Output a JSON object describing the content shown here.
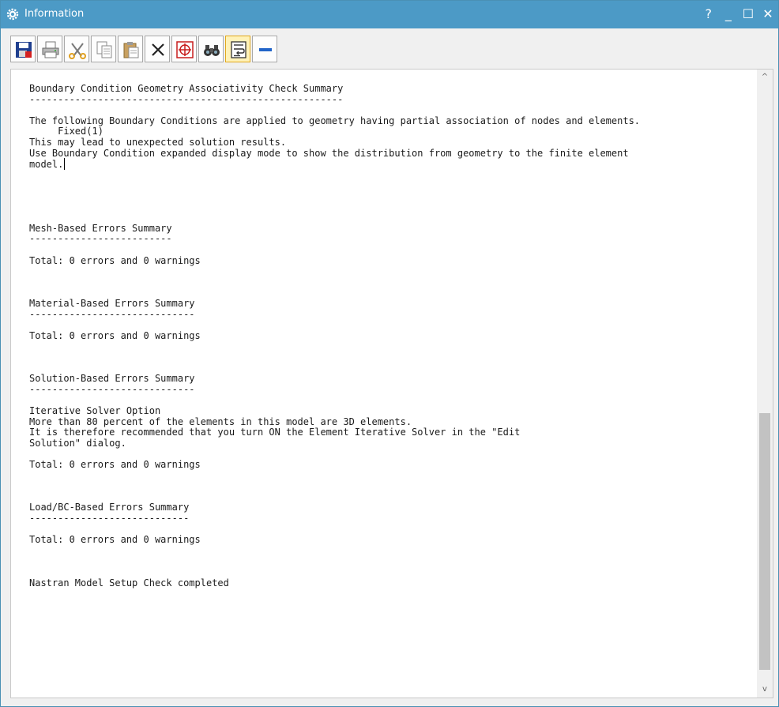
{
  "window": {
    "title": "Information",
    "controls": {
      "help": "?",
      "minimize": "_",
      "maximize": "☐",
      "close": "✕"
    }
  },
  "toolbar": {
    "buttons": [
      {
        "name": "save-button",
        "icon": "save-icon"
      },
      {
        "name": "print-button",
        "icon": "printer-icon"
      },
      {
        "name": "cut-button",
        "icon": "scissors-icon"
      },
      {
        "name": "copy-button",
        "icon": "copy-icon"
      },
      {
        "name": "paste-button",
        "icon": "paste-icon"
      },
      {
        "name": "delete-button",
        "icon": "x-icon"
      },
      {
        "name": "crosshair-button",
        "icon": "crosshair-icon"
      },
      {
        "name": "find-button",
        "icon": "binoculars-icon"
      },
      {
        "name": "word-wrap-button",
        "icon": "word-wrap-icon",
        "active": true
      },
      {
        "name": "collapse-button",
        "icon": "minus-icon"
      }
    ]
  },
  "content": {
    "lines": [
      "Boundary Condition Geometry Associativity Check Summary",
      "-------------------------------------------------------",
      "",
      "The following Boundary Conditions are applied to geometry having partial association of nodes and elements.",
      "     Fixed(1)",
      "This may lead to unexpected solution results.",
      "Use Boundary Condition expanded display mode to show the distribution from geometry to the finite element",
      "model.",
      "",
      "",
      "",
      "",
      "",
      "Mesh-Based Errors Summary",
      "-------------------------",
      "",
      "Total: 0 errors and 0 warnings",
      "",
      "",
      "",
      "Material-Based Errors Summary",
      "-----------------------------",
      "",
      "Total: 0 errors and 0 warnings",
      "",
      "",
      "",
      "Solution-Based Errors Summary",
      "-----------------------------",
      "",
      "Iterative Solver Option",
      "More than 80 percent of the elements in this model are 3D elements.",
      "It is therefore recommended that you turn ON the Element Iterative Solver in the \"Edit",
      "Solution\" dialog.",
      "",
      "Total: 0 errors and 0 warnings",
      "",
      "",
      "",
      "Load/BC-Based Errors Summary",
      "----------------------------",
      "",
      "Total: 0 errors and 0 warnings",
      "",
      "",
      "",
      "Nastran Model Setup Check completed"
    ],
    "caret_line": 7
  },
  "scrollbar": {
    "up_arrow": "^",
    "down_arrow": "v",
    "thumb_start_fraction": 0.55,
    "thumb_size_fraction": 0.43
  },
  "colors": {
    "titlebar": "#4c9ac6",
    "background": "#f0f0f0",
    "text": "#1a1a1a",
    "active_button": "#fff2b8"
  }
}
